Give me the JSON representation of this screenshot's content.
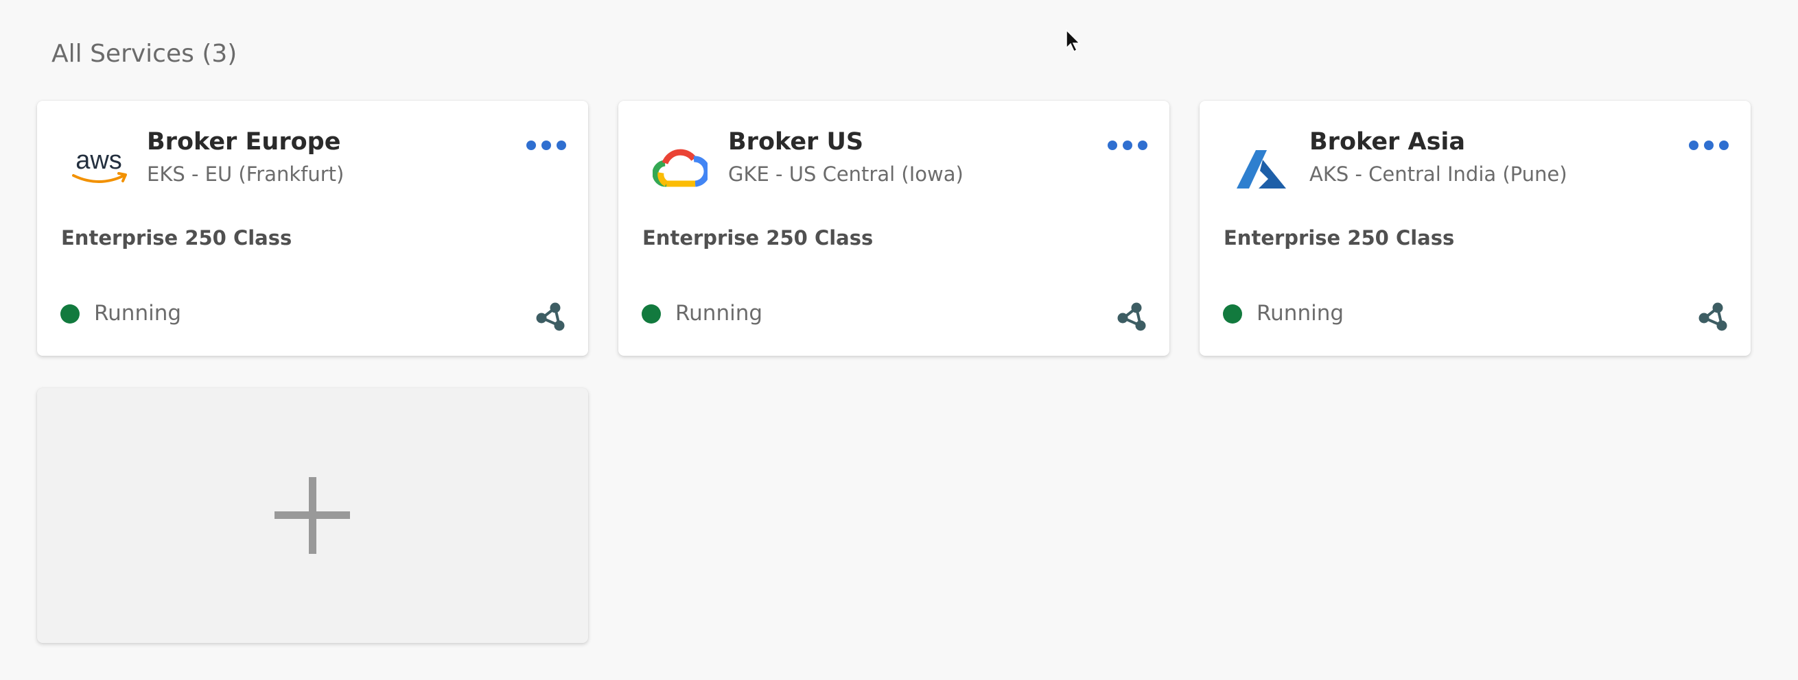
{
  "page": {
    "title": "All Services (3)"
  },
  "services": [
    {
      "name": "Broker Europe",
      "region": "EKS - EU (Frankfurt)",
      "plan": "Enterprise 250 Class",
      "status": "Running",
      "status_color": "#127a3e",
      "provider_icon": "aws-logo"
    },
    {
      "name": "Broker US",
      "region": "GKE - US Central (Iowa)",
      "plan": "Enterprise 250 Class",
      "status": "Running",
      "status_color": "#127a3e",
      "provider_icon": "google-cloud-logo"
    },
    {
      "name": "Broker Asia",
      "region": "AKS - Central India (Pune)",
      "plan": "Enterprise 250 Class",
      "status": "Running",
      "status_color": "#127a3e",
      "provider_icon": "azure-logo"
    }
  ],
  "add_card": {
    "icon": "plus-icon"
  },
  "colors": {
    "accent": "#2f6fd0",
    "share_icon": "#3d5d63",
    "background": "#f8f8f8"
  }
}
